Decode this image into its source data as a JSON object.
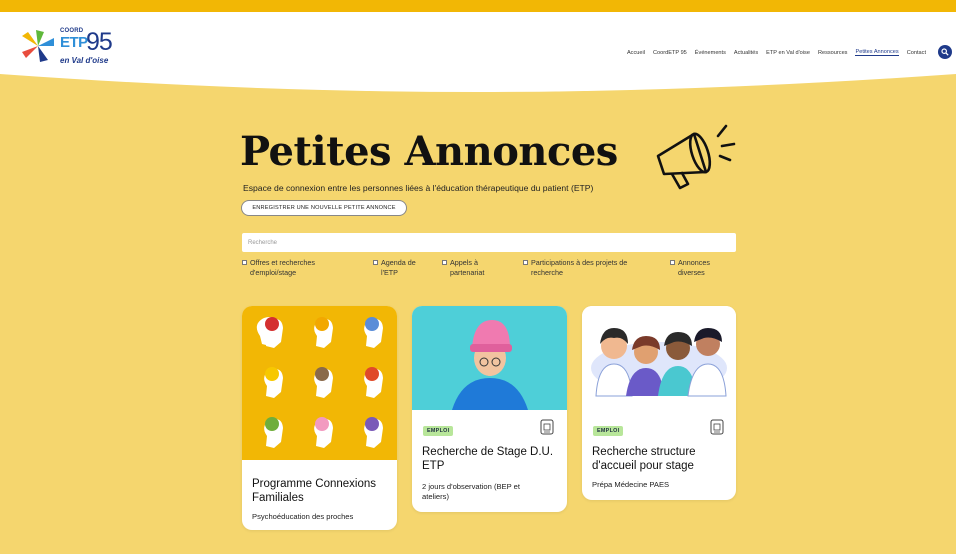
{
  "header": {
    "logo": {
      "coord": "COORD",
      "etp": "ETP",
      "number": "95",
      "region": "en Val d'oise"
    },
    "nav": [
      {
        "label": "Accueil"
      },
      {
        "label": "CoordETP 95"
      },
      {
        "label": "Événements"
      },
      {
        "label": "Actualités"
      },
      {
        "label": "ETP en Val d'oise"
      },
      {
        "label": "Ressources"
      },
      {
        "label": "Petites Annonces",
        "active": true
      },
      {
        "label": "Contact"
      }
    ],
    "search_icon": "search-icon"
  },
  "main": {
    "title": "Petites Annonces",
    "subtitle": "Espace de connexion entre les personnes liées à l'éducation thérapeutique du patient (ETP)",
    "register_button": "ENREGISTRER UNE NOUVELLE PETITE ANNONCE",
    "search_placeholder": "Recherche",
    "filters": [
      {
        "label1": "Offres et recherches",
        "label2": "d'emploi/stage"
      },
      {
        "label1": "Agenda de",
        "label2": "l'ETP"
      },
      {
        "label1": "Appels à",
        "label2": "partenariat"
      },
      {
        "label1": "Participations à des projets de",
        "label2": "recherche"
      },
      {
        "label1": "Annonces",
        "label2": "diverses"
      }
    ],
    "cards": [
      {
        "title1": "Programme Connexions",
        "title2": "Familiales",
        "desc1": "Psychoéducation des proches",
        "image": "flower-heads-image"
      },
      {
        "badge": "EMPLOI",
        "title1": "Recherche de Stage D.U.",
        "title2": "ETP",
        "desc1": "2 jours d'observation (BEP et",
        "desc2": "ateliers)",
        "image": "person-pink-hat-image"
      },
      {
        "badge": "EMPLOI",
        "title1": "Recherche structure",
        "title2": "d'accueil pour stage",
        "desc1": "Prépa Médecine PAES",
        "image": "medical-team-image"
      }
    ]
  },
  "colors": {
    "background": "#F5D66E",
    "top_strip": "#F2B705",
    "accent": "#1f3a8a",
    "badge": "#b8e69a"
  }
}
